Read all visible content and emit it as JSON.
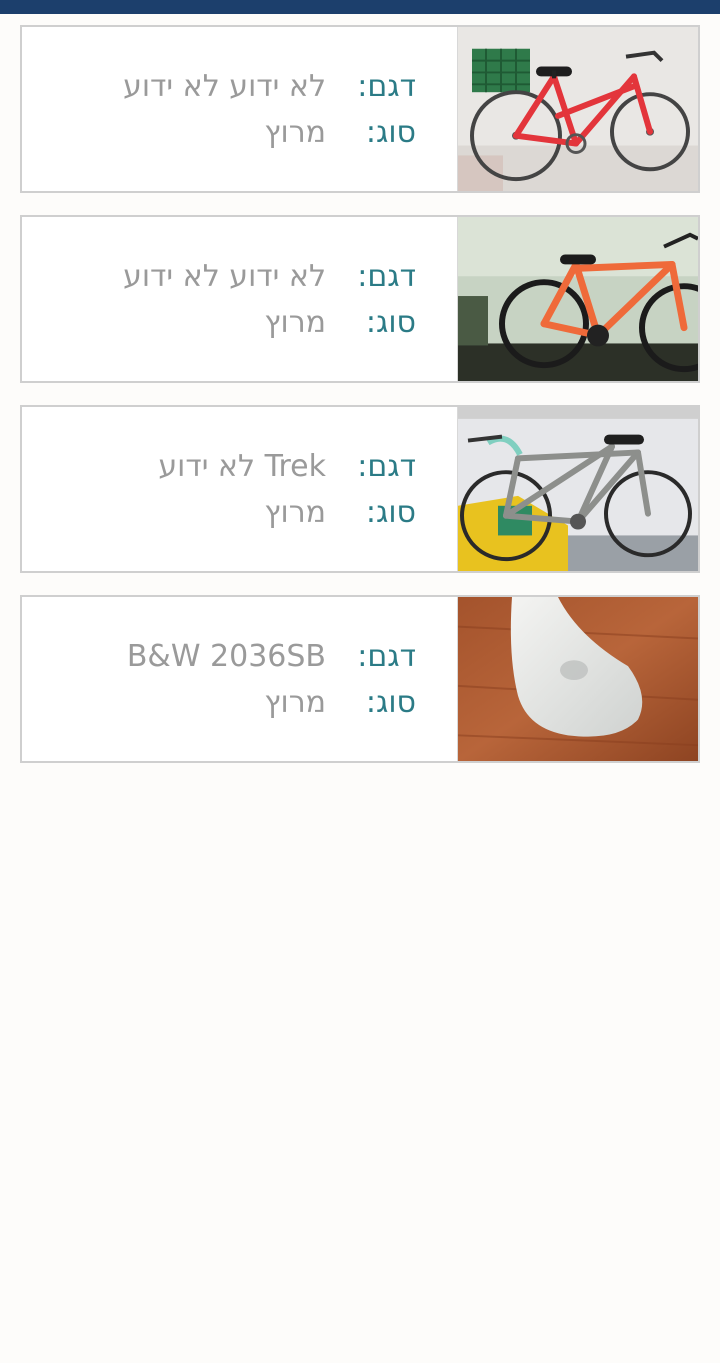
{
  "labels": {
    "model": "דגם:",
    "type": "סוג:"
  },
  "items": [
    {
      "model": "לא ידוע לא ידוע",
      "type": "מרוץ",
      "image": "red-city-bicycle-with-basket"
    },
    {
      "model": "לא ידוע לא ידוע",
      "type": "מרוץ",
      "image": "orange-bicycle"
    },
    {
      "model": "Trek לא ידוע",
      "type": "מרוץ",
      "image": "silver-road-bicycle"
    },
    {
      "model": "B&W 2036SB",
      "type": "מרוץ",
      "image": "white-bike-saddle-on-wood"
    }
  ],
  "colors": {
    "top_bar": "#1c3f6c",
    "label": "#2b7b86",
    "value": "#9a9a9a",
    "card_border": "#cfcfcf",
    "background": "#fdfcfa"
  }
}
